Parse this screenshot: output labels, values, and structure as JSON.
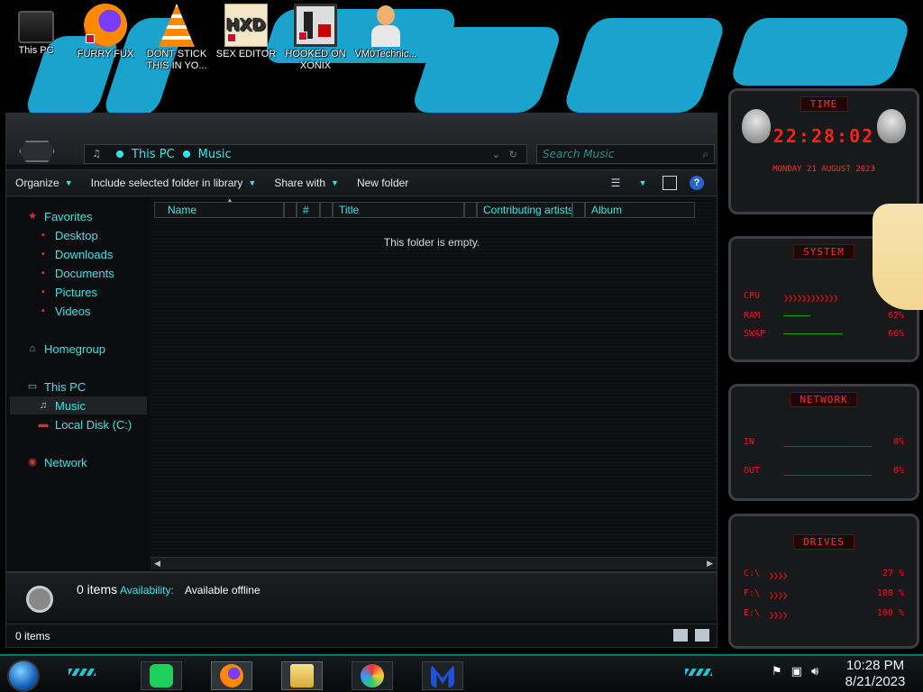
{
  "desktop": {
    "icons": [
      {
        "label": "This PC"
      },
      {
        "label": "FURRY FUX"
      },
      {
        "label": "DONT STICK THIS IN YO..."
      },
      {
        "label": "SEX EDITOR"
      },
      {
        "label": "HOOKED ON XONIX"
      },
      {
        "label": "VM0Technic..."
      }
    ]
  },
  "explorer": {
    "breadcrumb": [
      "This PC",
      "Music"
    ],
    "search_placeholder": "Search Music",
    "toolbar": {
      "organize": "Organize",
      "include": "Include selected folder in library",
      "share": "Share with",
      "new_folder": "New folder"
    },
    "nav": {
      "favorites": "Favorites",
      "desktop": "Desktop",
      "downloads": "Downloads",
      "documents": "Documents",
      "pictures": "Pictures",
      "videos": "Videos",
      "homegroup": "Homegroup",
      "this_pc": "This PC",
      "music": "Music",
      "local_disk": "Local Disk (C:)",
      "network": "Network"
    },
    "columns": [
      "Name",
      "#",
      "Title",
      "Contributing artists",
      "Album"
    ],
    "empty_message": "This folder is empty.",
    "details": {
      "count": "0 items",
      "availability_label": "Availability:",
      "availability_value": "Available offline"
    },
    "status": "0 items"
  },
  "gadgets": {
    "clock": {
      "title": "TIME",
      "time": "22:28:02",
      "date": "MONDAY 21 AUGUST 2023"
    },
    "system": {
      "title": "SYSTEM",
      "rows": [
        {
          "label": "CPU",
          "value": ""
        },
        {
          "label": "RAM",
          "value": "62%"
        },
        {
          "label": "SWAP",
          "value": "66%"
        }
      ]
    },
    "network": {
      "title": "NETWORK",
      "rows": [
        {
          "label": "IN",
          "value": "0%"
        },
        {
          "label": "OUT",
          "value": "0%"
        }
      ]
    },
    "drives": {
      "title": "DRIVES",
      "rows": [
        {
          "label": "C:\\",
          "value": "27 %"
        },
        {
          "label": "F:\\",
          "value": "100 %"
        },
        {
          "label": "E:\\",
          "value": "100 %"
        }
      ]
    }
  },
  "taskbar": {
    "time": "10:28 PM",
    "date": "8/21/2023"
  },
  "colors": {
    "accent": "#2ee6e6",
    "gadget_red": "#e8141a"
  }
}
